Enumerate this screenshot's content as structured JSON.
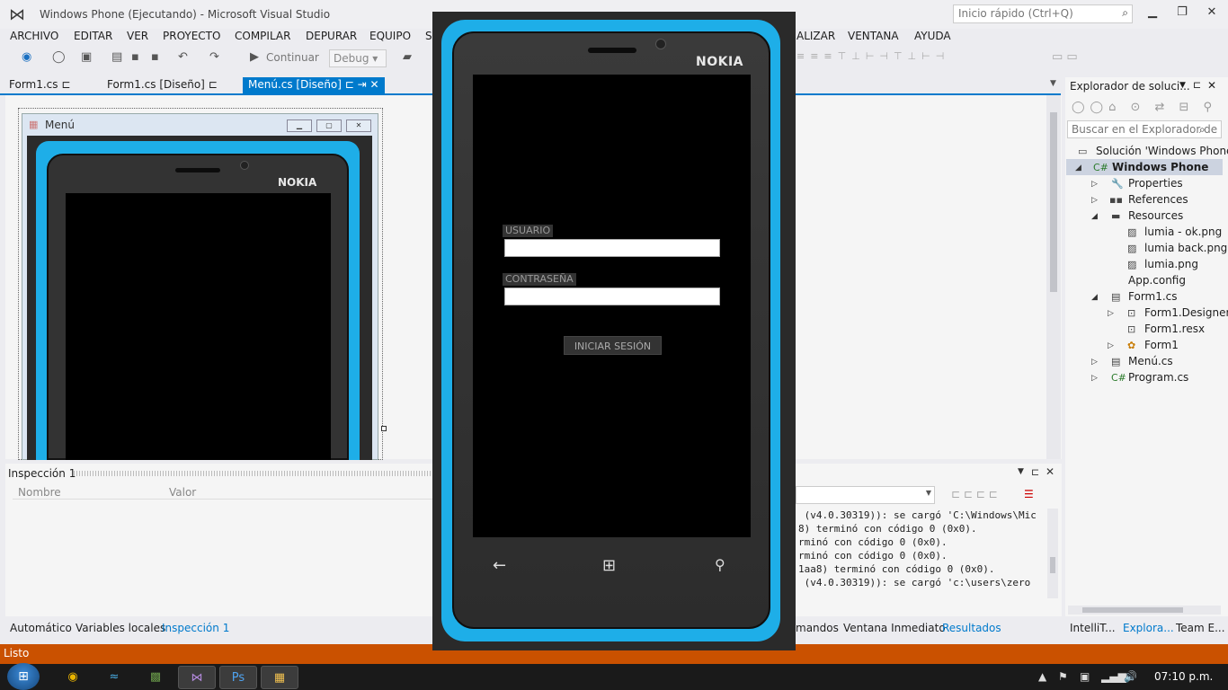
{
  "window": {
    "title": "Windows Phone (Ejecutando) - Microsoft Visual Studio",
    "quick_launch_placeholder": "Inicio rápido (Ctrl+Q)"
  },
  "menu": [
    "ARCHIVO",
    "EDITAR",
    "VER",
    "PROYECTO",
    "COMPILAR",
    "DEPURAR",
    "EQUIPO",
    "SQL",
    "ALIZAR",
    "VENTANA",
    "AYUDA"
  ],
  "toolbar": {
    "continue_label": "Continuar",
    "config": "Debug"
  },
  "tabs": [
    "Form1.cs",
    "Form1.cs [Diseño]",
    "Menú.cs [Diseño]"
  ],
  "designer": {
    "form_title": "Menú",
    "brand": "NOKIA"
  },
  "phone": {
    "brand": "NOKIA",
    "user_label": "USUARIO",
    "password_label": "CONTRASEÑA",
    "login_button": "INICIAR SESIÓN"
  },
  "inspection": {
    "title": "Inspección 1",
    "col_name": "Nombre",
    "col_value": "Valor"
  },
  "bottom_tabs_left": [
    "Automático",
    "Variables locales",
    "Inspección 1"
  ],
  "bottom_tabs_right": [
    "mandos",
    "Ventana Inmediato",
    "Resultados"
  ],
  "output": {
    "lines": [
      " (v4.0.30319)): se cargó 'C:\\Windows\\Mic",
      "8) terminó con código 0 (0x0).",
      "rminó con código 0 (0x0).",
      "rminó con código 0 (0x0).",
      "1aa8) terminó con código 0 (0x0).",
      " (v4.0.30319)): se cargó 'c:\\users\\zero"
    ]
  },
  "solution_explorer": {
    "title": "Explorador de soluci...",
    "search_placeholder": "Buscar en el Explorador de",
    "solution": "Solución 'Windows Phone'",
    "project": "Windows Phone",
    "items": {
      "properties": "Properties",
      "references": "References",
      "resources": "Resources",
      "res1": "lumia - ok.png",
      "res2": "lumia back.png",
      "res3": "lumia.png",
      "appconfig": "App.config",
      "form1": "Form1.cs",
      "form1designer": "Form1.Designer.",
      "form1resx": "Form1.resx",
      "form1class": "Form1",
      "menu": "Menú.cs",
      "program": "Program.cs"
    },
    "bottom_tabs": [
      "IntelliT...",
      "Explora...",
      "Team E..."
    ]
  },
  "status": "Listo",
  "clock": "07:10 p.m.",
  "colors": {
    "accent": "#007acc",
    "status_bar": "#ca5100",
    "phone_blue": "#1eaee8"
  }
}
